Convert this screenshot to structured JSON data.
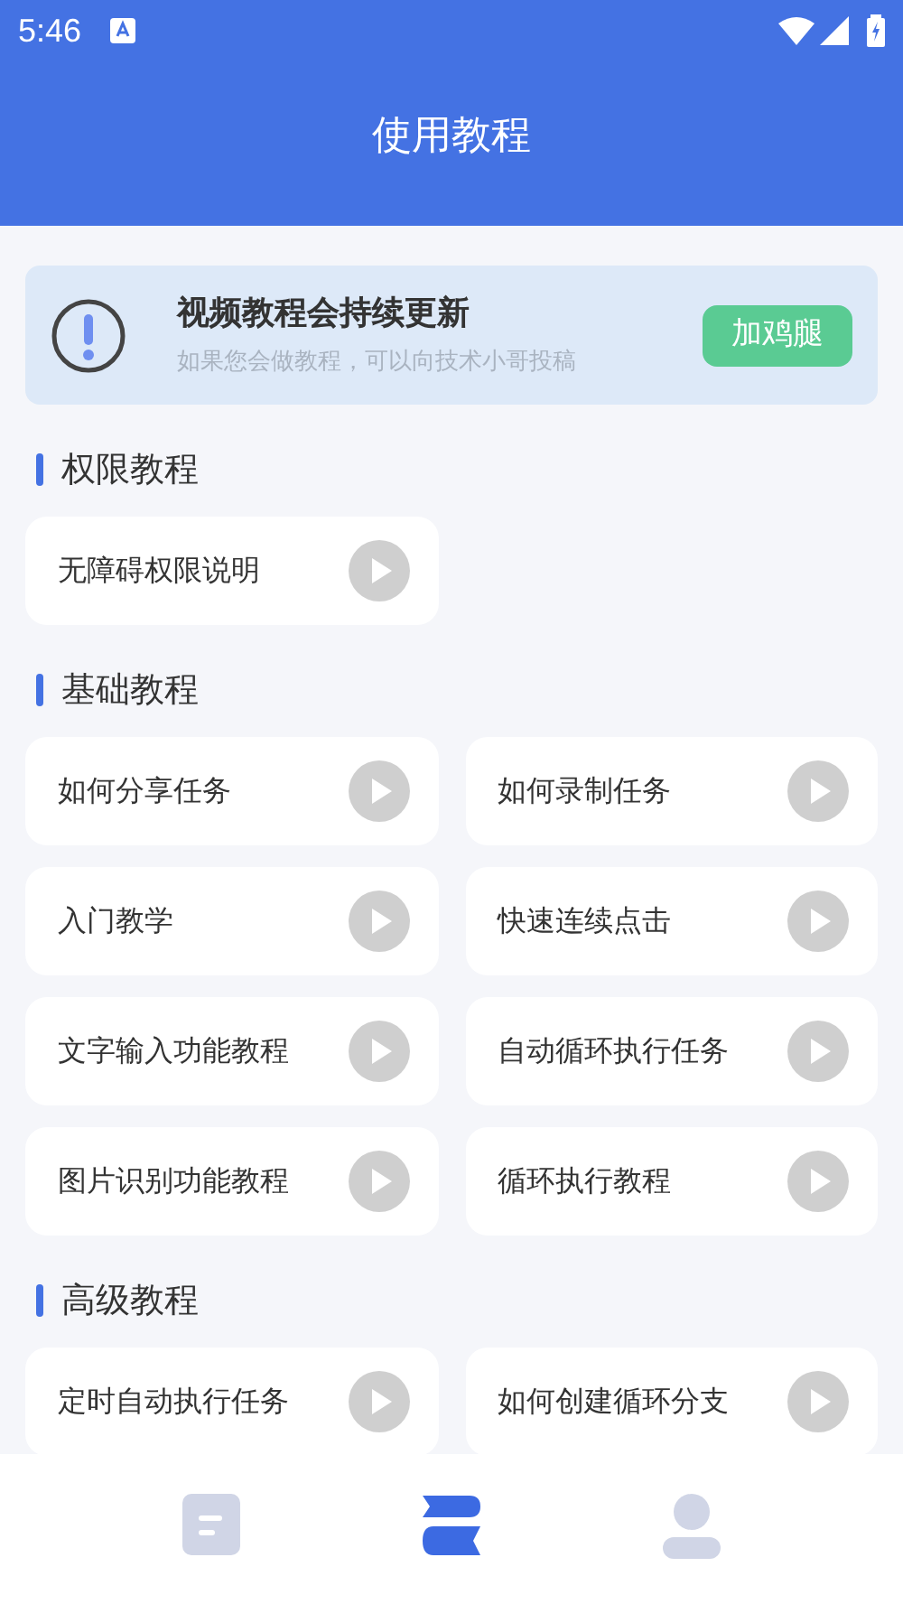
{
  "status_bar": {
    "time": "5:46"
  },
  "header": {
    "title": "使用教程"
  },
  "notice": {
    "title": "视频教程会持续更新",
    "subtitle": "如果您会做教程，可以向技术小哥投稿",
    "button": "加鸡腿"
  },
  "sections": [
    {
      "title": "权限教程",
      "items": [
        "无障碍权限说明"
      ]
    },
    {
      "title": "基础教程",
      "items": [
        "如何分享任务",
        "如何录制任务",
        "入门教学",
        "快速连续点击",
        "文字输入功能教程",
        "自动循环执行任务",
        "图片识别功能教程",
        "循环执行教程"
      ]
    },
    {
      "title": "高级教程",
      "items": [
        "定时自动执行任务",
        "如何创建循环分支"
      ]
    }
  ],
  "tabs": [
    {
      "kind": "document",
      "selected": false
    },
    {
      "kind": "stack",
      "selected": true
    },
    {
      "kind": "person",
      "selected": false
    }
  ]
}
